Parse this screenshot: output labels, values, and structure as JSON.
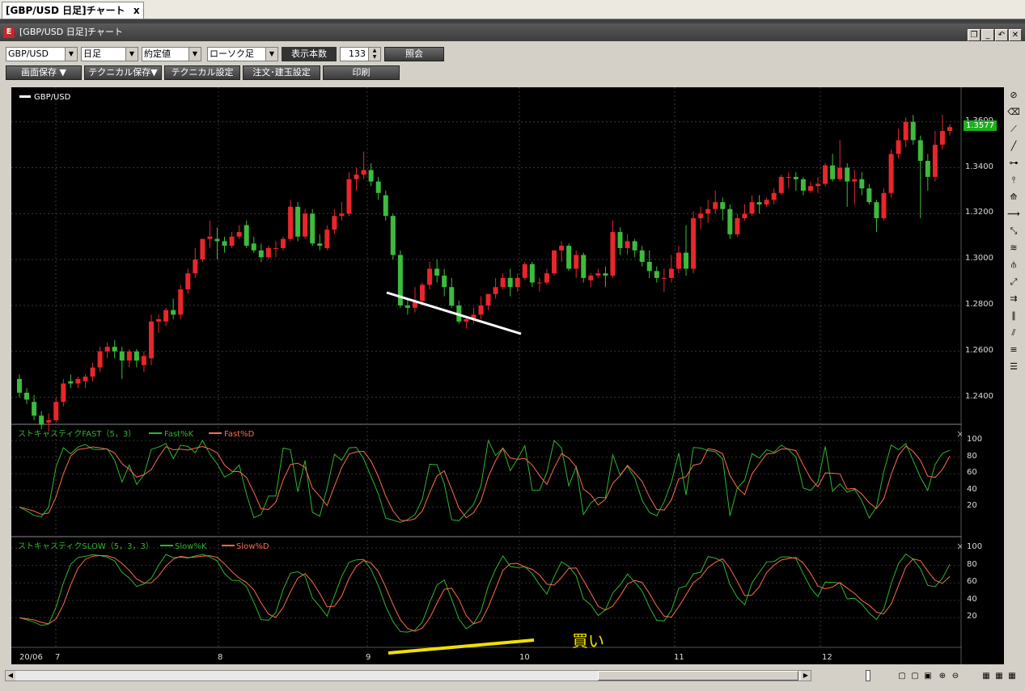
{
  "doc_tab": {
    "title": "[GBP/USD 日足]チャート",
    "close": "x"
  },
  "window": {
    "title": "[GBP/USD 日足]チャート",
    "logo": "E",
    "buttons": [
      "restore-icon",
      "minimize-icon",
      "undo-icon",
      "close-icon"
    ]
  },
  "toolbar": {
    "symbol": "GBP/USD",
    "period": "日足",
    "price_type": "約定値",
    "chart_type": "ローソク足",
    "count_label": "表示本数",
    "count_value": "133",
    "query_button": "照会",
    "save_screen": "画面保存 ▼",
    "save_technical": "テクニカル保存▼",
    "technical_settings": "テクニカル設定",
    "order_settings": "注文･建玉設定",
    "print": "印刷"
  },
  "price_panel": {
    "legend": "GBP/USD",
    "y_ticks": [
      "1.3600",
      "1.3400",
      "1.3200",
      "1.3000",
      "1.2800",
      "1.2600",
      "1.2400"
    ],
    "current_price": "1.3577",
    "colors": {
      "up": "#e8262b",
      "down": "#3dbb3d",
      "current": "#1db01d"
    }
  },
  "fast_panel": {
    "title": "ストキャスティクFAST（5，3）",
    "k_label": "Fast%K",
    "d_label": "Fast%D",
    "y_ticks": [
      "100",
      "80",
      "60",
      "40",
      "20"
    ]
  },
  "slow_panel": {
    "title": "ストキャスティクSLOW（5，3，3）",
    "k_label": "Slow%K",
    "d_label": "Slow%D",
    "y_ticks": [
      "100",
      "80",
      "60",
      "40",
      "20"
    ],
    "annotation": "買い"
  },
  "x_axis": {
    "labels": [
      "20/06",
      "7",
      "8",
      "9",
      "10",
      "11",
      "12"
    ]
  },
  "right_toolbar_icons": [
    "no-draw-icon",
    "eraser-icon",
    "trendline-icon",
    "line-icon",
    "horizontal-line-icon",
    "vertical-line-icon",
    "fibonacci-fan-icon",
    "fibonacci-arc-icon",
    "regression-icon",
    "fibonacci-retracement-icon",
    "pitchfork-icon",
    "gann-fan-icon",
    "cycle-icon",
    "channel-icon",
    "parallel-icon",
    "equal-lines-icon",
    "level-lines-icon"
  ],
  "bottom_icons": [
    "page-icon-1",
    "page-icon-2",
    "image-icon",
    "zoom-in-icon",
    "zoom-out-icon",
    "tile-icon-1",
    "tile-icon-2",
    "tile-icon-3"
  ],
  "chart_data": {
    "type": "candlestick",
    "series": [
      {
        "name": "GBP/USD",
        "ohlc": [
          [
            1.248,
            1.25,
            1.24,
            1.242
          ],
          [
            1.242,
            1.244,
            1.237,
            1.239
          ],
          [
            1.238,
            1.241,
            1.23,
            1.232
          ],
          [
            1.232,
            1.234,
            1.226,
            1.228
          ],
          [
            1.229,
            1.233,
            1.225,
            1.23
          ],
          [
            1.23,
            1.24,
            1.229,
            1.238
          ],
          [
            1.238,
            1.248,
            1.236,
            1.246
          ],
          [
            1.247,
            1.25,
            1.244,
            1.246
          ],
          [
            1.246,
            1.249,
            1.244,
            1.248
          ],
          [
            1.247,
            1.25,
            1.244,
            1.249
          ],
          [
            1.249,
            1.255,
            1.247,
            1.253
          ],
          [
            1.253,
            1.262,
            1.251,
            1.26
          ],
          [
            1.26,
            1.264,
            1.257,
            1.262
          ],
          [
            1.262,
            1.265,
            1.257,
            1.26
          ],
          [
            1.26,
            1.262,
            1.248,
            1.256
          ],
          [
            1.256,
            1.261,
            1.253,
            1.26
          ],
          [
            1.26,
            1.261,
            1.253,
            1.256
          ],
          [
            1.254,
            1.26,
            1.251,
            1.258
          ],
          [
            1.257,
            1.276,
            1.254,
            1.273
          ],
          [
            1.273,
            1.276,
            1.268,
            1.274
          ],
          [
            1.273,
            1.279,
            1.271,
            1.278
          ],
          [
            1.278,
            1.283,
            1.274,
            1.276
          ],
          [
            1.276,
            1.289,
            1.274,
            1.287
          ],
          [
            1.287,
            1.296,
            1.285,
            1.294
          ],
          [
            1.294,
            1.305,
            1.292,
            1.3
          ],
          [
            1.3,
            1.309,
            1.299,
            1.309
          ],
          [
            1.309,
            1.317,
            1.305,
            1.31
          ],
          [
            1.309,
            1.314,
            1.3,
            1.308
          ],
          [
            1.308,
            1.31,
            1.303,
            1.306
          ],
          [
            1.306,
            1.312,
            1.305,
            1.31
          ],
          [
            1.31,
            1.315,
            1.309,
            1.312
          ],
          [
            1.315,
            1.317,
            1.305,
            1.306
          ],
          [
            1.307,
            1.31,
            1.303,
            1.304
          ],
          [
            1.304,
            1.307,
            1.299,
            1.301
          ],
          [
            1.301,
            1.306,
            1.3,
            1.305
          ],
          [
            1.305,
            1.308,
            1.301,
            1.305
          ],
          [
            1.305,
            1.31,
            1.304,
            1.309
          ],
          [
            1.309,
            1.326,
            1.308,
            1.323
          ],
          [
            1.323,
            1.325,
            1.308,
            1.31
          ],
          [
            1.31,
            1.322,
            1.309,
            1.32
          ],
          [
            1.32,
            1.322,
            1.306,
            1.307
          ],
          [
            1.307,
            1.311,
            1.304,
            1.306
          ],
          [
            1.305,
            1.315,
            1.304,
            1.313
          ],
          [
            1.313,
            1.322,
            1.311,
            1.319
          ],
          [
            1.319,
            1.325,
            1.317,
            1.32
          ],
          [
            1.32,
            1.338,
            1.319,
            1.335
          ],
          [
            1.335,
            1.34,
            1.33,
            1.337
          ],
          [
            1.337,
            1.347,
            1.335,
            1.339
          ],
          [
            1.339,
            1.342,
            1.332,
            1.334
          ],
          [
            1.334,
            1.336,
            1.326,
            1.329
          ],
          [
            1.328,
            1.33,
            1.317,
            1.319
          ],
          [
            1.319,
            1.32,
            1.3,
            1.302
          ],
          [
            1.302,
            1.304,
            1.279,
            1.28
          ],
          [
            1.28,
            1.283,
            1.276,
            1.279
          ],
          [
            1.279,
            1.288,
            1.277,
            1.282
          ],
          [
            1.282,
            1.29,
            1.28,
            1.289
          ],
          [
            1.289,
            1.299,
            1.287,
            1.296
          ],
          [
            1.296,
            1.3,
            1.29,
            1.293
          ],
          [
            1.293,
            1.296,
            1.284,
            1.288
          ],
          [
            1.288,
            1.292,
            1.279,
            1.28
          ],
          [
            1.28,
            1.282,
            1.272,
            1.273
          ],
          [
            1.273,
            1.275,
            1.27,
            1.274
          ],
          [
            1.274,
            1.279,
            1.272,
            1.276
          ],
          [
            1.276,
            1.284,
            1.274,
            1.28
          ],
          [
            1.28,
            1.285,
            1.278,
            1.285
          ],
          [
            1.285,
            1.292,
            1.283,
            1.288
          ],
          [
            1.288,
            1.294,
            1.287,
            1.292
          ],
          [
            1.292,
            1.296,
            1.284,
            1.288
          ],
          [
            1.288,
            1.294,
            1.286,
            1.292
          ],
          [
            1.292,
            1.299,
            1.291,
            1.298
          ],
          [
            1.298,
            1.299,
            1.288,
            1.29
          ],
          [
            1.29,
            1.292,
            1.286,
            1.29
          ],
          [
            1.29,
            1.296,
            1.289,
            1.294
          ],
          [
            1.294,
            1.304,
            1.293,
            1.304
          ],
          [
            1.304,
            1.308,
            1.299,
            1.306
          ],
          [
            1.306,
            1.307,
            1.295,
            1.296
          ],
          [
            1.296,
            1.304,
            1.292,
            1.302
          ],
          [
            1.302,
            1.303,
            1.29,
            1.292
          ],
          [
            1.291,
            1.294,
            1.288,
            1.293
          ],
          [
            1.293,
            1.296,
            1.292,
            1.294
          ],
          [
            1.294,
            1.297,
            1.288,
            1.293
          ],
          [
            1.293,
            1.317,
            1.292,
            1.312
          ],
          [
            1.312,
            1.314,
            1.302,
            1.305
          ],
          [
            1.305,
            1.311,
            1.302,
            1.308
          ],
          [
            1.308,
            1.309,
            1.301,
            1.304
          ],
          [
            1.304,
            1.306,
            1.297,
            1.299
          ],
          [
            1.299,
            1.304,
            1.292,
            1.295
          ],
          [
            1.295,
            1.297,
            1.29,
            1.292
          ],
          [
            1.292,
            1.296,
            1.286,
            1.292
          ],
          [
            1.292,
            1.302,
            1.29,
            1.296
          ],
          [
            1.296,
            1.306,
            1.294,
            1.303
          ],
          [
            1.303,
            1.315,
            1.293,
            1.296
          ],
          [
            1.296,
            1.321,
            1.294,
            1.318
          ],
          [
            1.318,
            1.323,
            1.313,
            1.32
          ],
          [
            1.32,
            1.326,
            1.316,
            1.322
          ],
          [
            1.322,
            1.33,
            1.32,
            1.325
          ],
          [
            1.325,
            1.327,
            1.317,
            1.322
          ],
          [
            1.322,
            1.324,
            1.309,
            1.311
          ],
          [
            1.311,
            1.32,
            1.31,
            1.318
          ],
          [
            1.318,
            1.324,
            1.317,
            1.32
          ],
          [
            1.32,
            1.328,
            1.319,
            1.325
          ],
          [
            1.325,
            1.328,
            1.32,
            1.324
          ],
          [
            1.324,
            1.327,
            1.323,
            1.326
          ],
          [
            1.326,
            1.331,
            1.324,
            1.329
          ],
          [
            1.329,
            1.337,
            1.328,
            1.336
          ],
          [
            1.336,
            1.338,
            1.331,
            1.336
          ],
          [
            1.336,
            1.338,
            1.33,
            1.335
          ],
          [
            1.335,
            1.336,
            1.328,
            1.33
          ],
          [
            1.33,
            1.334,
            1.329,
            1.332
          ],
          [
            1.332,
            1.336,
            1.329,
            1.333
          ],
          [
            1.333,
            1.342,
            1.332,
            1.341
          ],
          [
            1.341,
            1.346,
            1.334,
            1.335
          ],
          [
            1.335,
            1.352,
            1.334,
            1.34
          ],
          [
            1.34,
            1.342,
            1.323,
            1.334
          ],
          [
            1.334,
            1.339,
            1.324,
            1.335
          ],
          [
            1.335,
            1.338,
            1.328,
            1.331
          ],
          [
            1.331,
            1.333,
            1.324,
            1.325
          ],
          [
            1.325,
            1.326,
            1.312,
            1.318
          ],
          [
            1.318,
            1.331,
            1.317,
            1.329
          ],
          [
            1.329,
            1.348,
            1.327,
            1.346
          ],
          [
            1.346,
            1.357,
            1.344,
            1.352
          ],
          [
            1.352,
            1.362,
            1.349,
            1.36
          ],
          [
            1.36,
            1.363,
            1.35,
            1.352
          ],
          [
            1.352,
            1.354,
            1.318,
            1.343
          ],
          [
            1.343,
            1.346,
            1.33,
            1.336
          ],
          [
            1.336,
            1.356,
            1.334,
            1.35
          ],
          [
            1.35,
            1.363,
            1.348,
            1.356
          ],
          [
            1.356,
            1.359,
            1.354,
            1.3577
          ]
        ]
      }
    ],
    "ylim": [
      1.23,
      1.368
    ],
    "x_labels": [
      "20/06",
      "7",
      "8",
      "9",
      "10",
      "11",
      "12"
    ],
    "annotations": [
      {
        "type": "trendline",
        "color": "#ffffff"
      },
      {
        "type": "trendline",
        "color": "#f0e000",
        "text": "買い"
      }
    ]
  }
}
